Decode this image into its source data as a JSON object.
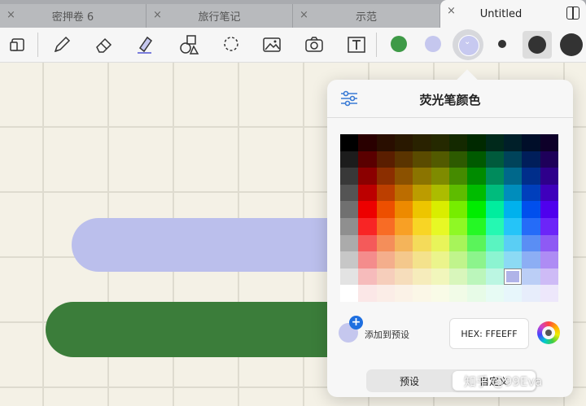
{
  "tabs": [
    {
      "label": "密押卷 6",
      "close": "×"
    },
    {
      "label": "旅行笔记",
      "close": "×"
    },
    {
      "label": "示范",
      "close": "×"
    },
    {
      "label": "Untitled",
      "close": "×"
    }
  ],
  "toolbar": {
    "tools": [
      "page-switch-icon",
      "pen-icon",
      "eraser-icon",
      "highlighter-icon",
      "shapes-icon",
      "lasso-icon",
      "image-icon",
      "camera-icon",
      "text-icon"
    ],
    "colors": [
      "#3e9a47",
      "#c5c7ee",
      "#c7c9f0"
    ],
    "sizes": [
      "small",
      "medium",
      "large"
    ]
  },
  "popover": {
    "title": "荧光笔颜色",
    "add_label": "添加到预设",
    "hex_label": "HEX:",
    "hex_value": "FFEEFF",
    "seg_presets": "预设",
    "seg_custom": "自定义",
    "selected_color": "#b0b3e8"
  },
  "watermark": "知乎 @99Eva"
}
